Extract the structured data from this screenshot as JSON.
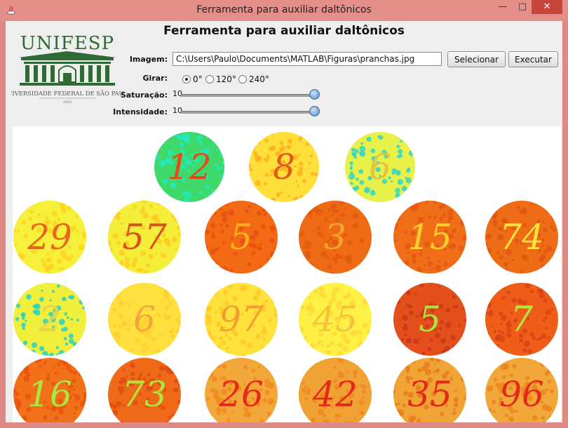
{
  "window": {
    "title": "Ferramenta para auxiliar daltônicos",
    "minimize": "—",
    "maximize": "□",
    "close": "✕"
  },
  "heading": "Ferramenta para auxiliar daltônicos",
  "logo": {
    "name": "UNIFESP",
    "subtitle": "UNIVERSIDADE FEDERAL DE SÃO PAULO",
    "year": "1933"
  },
  "form": {
    "image_label": "Imagem:",
    "image_path": "C:\\Users\\Paulo\\Documents\\MATLAB\\Figuras\\pranchas.jpg",
    "select_button": "Selecionar",
    "run_button": "Executar",
    "rotate_label": "Girar:",
    "rotate_options": [
      "0°",
      "120°",
      "240°"
    ],
    "rotate_selected": "0°",
    "saturation_label": "Saturação:",
    "saturation_value": "10",
    "intensity_label": "Intensidade:",
    "intensity_value": "10"
  },
  "plates": [
    {
      "number": "12",
      "bg": "#3fd96a",
      "dots": "#22e8c0",
      "digit": "#e24b1a"
    },
    {
      "number": "8",
      "bg": "#ffe03a",
      "dots": "#ffb020",
      "digit": "#e25a1a"
    },
    {
      "number": "6",
      "bg": "#e8f04a",
      "dots": "#2fd6c8",
      "digit": "#e8c23a"
    },
    {
      "number": "29",
      "bg": "#f6f03a",
      "dots": "#ffd21e",
      "digit": "#e6661e"
    },
    {
      "number": "57",
      "bg": "#f4ee3a",
      "dots": "#ffcc20",
      "digit": "#d9501a"
    },
    {
      "number": "5",
      "bg": "#f26a14",
      "dots": "#e85010",
      "digit": "#ffb020"
    },
    {
      "number": "3",
      "bg": "#ee6a14",
      "dots": "#e05a10",
      "digit": "#f3a62a"
    },
    {
      "number": "15",
      "bg": "#f06e18",
      "dots": "#e55812",
      "digit": "#ffd02a"
    },
    {
      "number": "74",
      "bg": "#ef6c16",
      "dots": "#e25610",
      "digit": "#ffe23a"
    },
    {
      "number": "2",
      "bg": "#f0f03c",
      "dots": "#28d0c8",
      "digit": "#e8d24a"
    },
    {
      "number": "6",
      "bg": "#ffe03e",
      "dots": "#ffcf30",
      "digit": "#f1a83a"
    },
    {
      "number": "97",
      "bg": "#ffe23c",
      "dots": "#ffc82a",
      "digit": "#f1a030"
    },
    {
      "number": "45",
      "bg": "#fff045",
      "dots": "#ffd838",
      "digit": "#f6c23a"
    },
    {
      "number": "5",
      "bg": "#e4501c",
      "dots": "#c8381a",
      "digit": "#a8e640"
    },
    {
      "number": "7",
      "bg": "#ee5e18",
      "dots": "#d84414",
      "digit": "#b4e83c"
    },
    {
      "number": "16",
      "bg": "#f27018",
      "dots": "#e55410",
      "digit": "#a8e840"
    },
    {
      "number": "73",
      "bg": "#ef6a18",
      "dots": "#e04c12",
      "digit": "#b0e63c"
    },
    {
      "number": "26",
      "bg": "#f2a838",
      "dots": "#f08a20",
      "digit": "#e8281a"
    },
    {
      "number": "42",
      "bg": "#f0a234",
      "dots": "#ee8820",
      "digit": "#e62a1a"
    },
    {
      "number": "35",
      "bg": "#f0a434",
      "dots": "#e67e22",
      "digit": "#e22818"
    },
    {
      "number": "96",
      "bg": "#f2a838",
      "dots": "#ea8420",
      "digit": "#e4281a"
    }
  ]
}
